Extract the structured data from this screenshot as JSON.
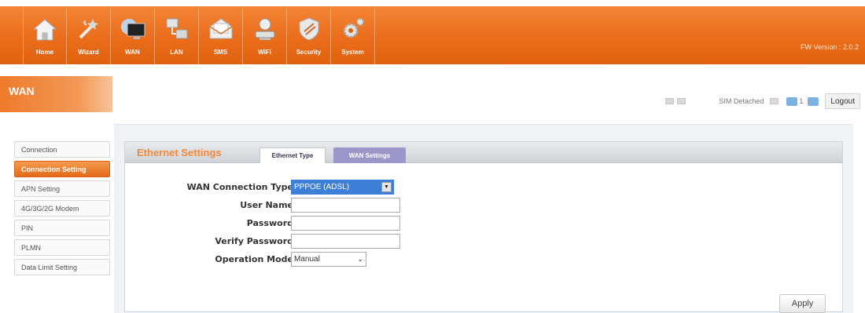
{
  "nav": [
    {
      "label": "Home",
      "icon": "home-icon"
    },
    {
      "label": "Wizard",
      "icon": "wizard-icon"
    },
    {
      "label": "WAN",
      "icon": "wan-icon"
    },
    {
      "label": "LAN",
      "icon": "lan-icon"
    },
    {
      "label": "SMS",
      "icon": "sms-icon"
    },
    {
      "label": "WiFi",
      "icon": "wifi-icon"
    },
    {
      "label": "Security",
      "icon": "security-icon"
    },
    {
      "label": "System",
      "icon": "system-icon"
    }
  ],
  "fw_version": "FW Version : 2.0.2",
  "section_title": "WAN",
  "status": {
    "sim": "SIM Detached",
    "connected_count": "1",
    "logout_label": "Logout"
  },
  "sidebar": [
    {
      "label": "Connection",
      "active": false
    },
    {
      "label": "Connection Setting",
      "active": true
    },
    {
      "label": "APN Setting",
      "active": false
    },
    {
      "label": "4G/3G/2G Modem",
      "active": false
    },
    {
      "label": "PIN",
      "active": false
    },
    {
      "label": "PLMN",
      "active": false
    },
    {
      "label": "Data Limit Setting",
      "active": false
    }
  ],
  "panel": {
    "title": "Ethernet Settings",
    "tabs": [
      "Ethernet Type",
      "WAN Settings"
    ]
  },
  "form": {
    "wan_connection_type": {
      "label": "WAN Connection Type",
      "value": "PPPOE (ADSL)"
    },
    "user_name": {
      "label": "User Name",
      "value": ""
    },
    "password": {
      "label": "Password",
      "value": ""
    },
    "verify_password": {
      "label": "Verify Password",
      "value": ""
    },
    "operation_mode": {
      "label": "Operation Mode",
      "value": "Manual"
    }
  },
  "apply_label": "Apply",
  "colors": {
    "accent": "#ea6d1c",
    "tab_active": "#9c97c9",
    "select_highlight": "#3d7fd7"
  }
}
